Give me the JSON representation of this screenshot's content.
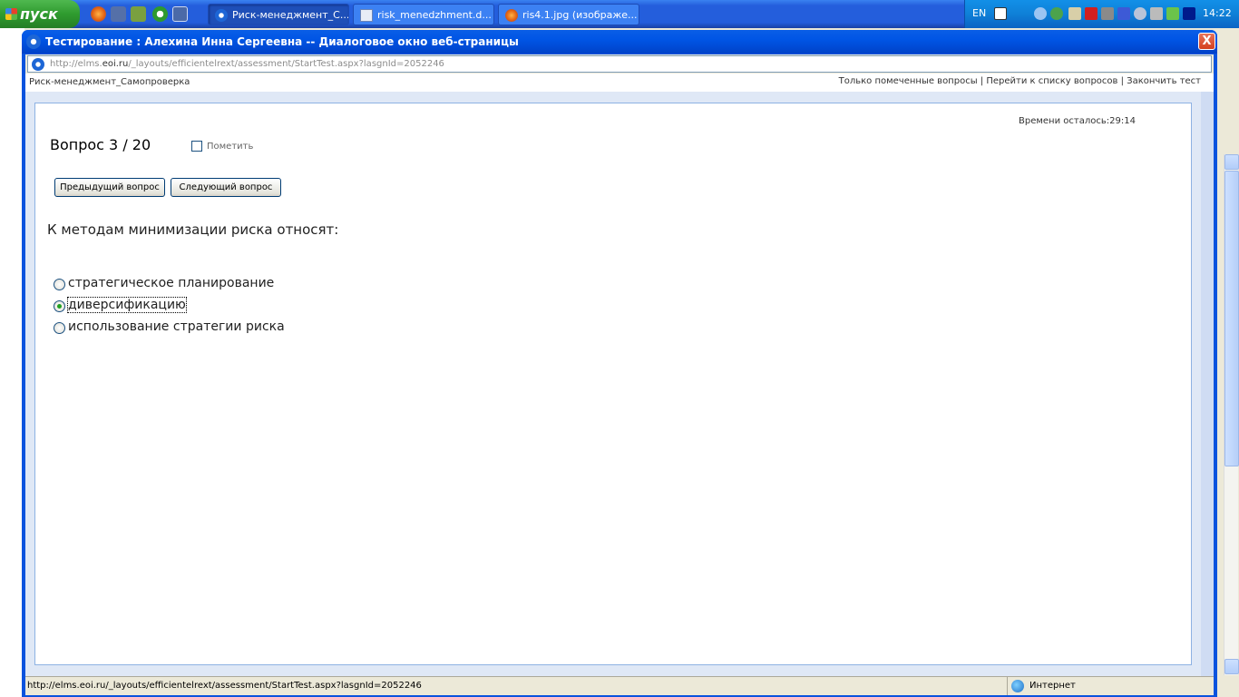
{
  "taskbar": {
    "start_label": "пуск",
    "tasks": [
      {
        "label": "Риск-менеджмент_С..."
      },
      {
        "label": "risk_menedzhment.d..."
      },
      {
        "label": "ris4.1.jpg (изображе..."
      }
    ],
    "lang": "EN",
    "clock": "14:22"
  },
  "dialog": {
    "title": "Тестирование : Алехина Инна Сергеевна -- Диалоговое окно веб-страницы",
    "url_prefix": "http://elms.",
    "url_domain": "eoi.ru",
    "url_rest": "/_layouts/efficientelrext/assessment/StartTest.aspx?lasgnId=2052246",
    "close_label": "X"
  },
  "topbar": {
    "course": "Риск-менеджмент_Самопроверка",
    "links": [
      "Только помеченные вопросы",
      "Перейти к списку вопросов",
      "Закончить тест"
    ],
    "separator": " | "
  },
  "quiz": {
    "timer": "Времени осталось:29:14",
    "question_number": "Вопрос 3 / 20",
    "mark_label": "Пометить",
    "prev_button": "Предыдущий вопрос",
    "next_button": "Следующий вопрос",
    "question_text": "К методам минимизации риска относят:",
    "options": [
      {
        "label": "стратегическое планирование",
        "selected": false
      },
      {
        "label": "диверсификацию",
        "selected": true
      },
      {
        "label": "использование стратегии риска",
        "selected": false
      }
    ]
  },
  "statusbar": {
    "url": "http://elms.eoi.ru/_layouts/efficientelrext/assessment/StartTest.aspx?lasgnId=2052246",
    "zone": "Интернет"
  }
}
